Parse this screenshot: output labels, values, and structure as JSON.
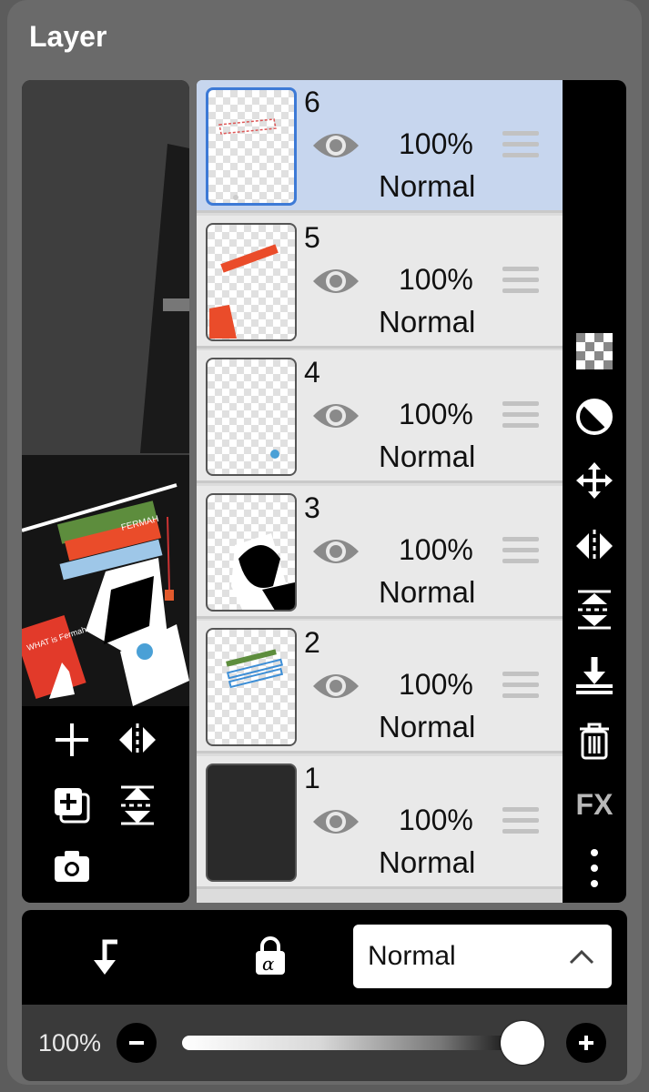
{
  "panel": {
    "title": "Layer"
  },
  "layers": [
    {
      "number": "6",
      "opacity": "100%",
      "blend": "Normal",
      "selected": true,
      "visible": true
    },
    {
      "number": "5",
      "opacity": "100%",
      "blend": "Normal",
      "selected": false,
      "visible": true
    },
    {
      "number": "4",
      "opacity": "100%",
      "blend": "Normal",
      "selected": false,
      "visible": true
    },
    {
      "number": "3",
      "opacity": "100%",
      "blend": "Normal",
      "selected": false,
      "visible": true
    },
    {
      "number": "2",
      "opacity": "100%",
      "blend": "Normal",
      "selected": false,
      "visible": true
    },
    {
      "number": "1",
      "opacity": "100%",
      "blend": "Normal",
      "selected": false,
      "visible": true
    }
  ],
  "preview": {
    "book_spine_letters": "FERMAH",
    "book_cover_text": "WHAT is Fermah"
  },
  "left_tools": [
    "add-icon",
    "flip-horizontal-icon",
    "add-layer-copy-icon",
    "flip-vertical-icon",
    "camera-icon"
  ],
  "right_tools": [
    "transparency-icon",
    "contrast-icon",
    "move-icon",
    "flip-horizontal-icon",
    "flip-vertical-icon",
    "merge-down-icon",
    "trash-icon",
    "fx-icon",
    "more-icon"
  ],
  "right_fx_label": "FX",
  "bottom": {
    "blend_mode": "Normal",
    "clip_icon": "clip-arrow-icon",
    "lock_icon": "alpha-lock-icon"
  },
  "opacity": {
    "label": "100%",
    "value": 1.0
  },
  "colors": {
    "selected_row": "#c7d6ee",
    "accent_border": "#3d7ad6",
    "panel_bg": "#6a6a6a"
  }
}
